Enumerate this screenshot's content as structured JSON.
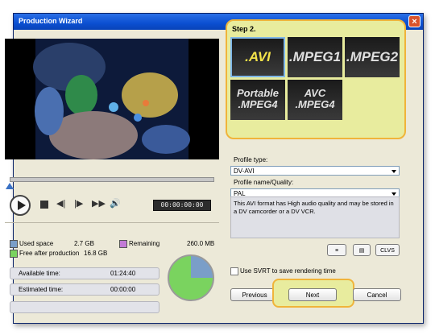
{
  "window": {
    "title": "Production Wizard",
    "close_symbol": "×"
  },
  "player": {
    "timecode": "00:00:00:00"
  },
  "disk": {
    "used_label": "Used space",
    "used_value": "2.7 GB",
    "remaining_label": "Remaining",
    "remaining_value": "260.0 MB",
    "free_label": "Free after production",
    "free_value": "16.8 GB",
    "used_color": "#7a9ec8",
    "free_color": "#7ad35f",
    "remaining_color": "#c27ad6"
  },
  "times": {
    "available_label": "Available time:",
    "available_value": "01:24:40",
    "estimated_label": "Estimated time:",
    "estimated_value": "00:00:00"
  },
  "step": {
    "label": "Step 2.",
    "formats": [
      {
        "line1": ".AVI",
        "line2": "",
        "selected": true
      },
      {
        "line1": ".MPEG1",
        "line2": "",
        "selected": false
      },
      {
        "line1": ".MPEG2",
        "line2": "",
        "selected": false
      },
      {
        "line1": "Portable",
        "line2": ".MPEG4",
        "selected": false
      },
      {
        "line1": "AVC",
        "line2": ".MPEG4",
        "selected": false
      }
    ]
  },
  "profile": {
    "type_label": "Profile type:",
    "type_value": "DV-AVI",
    "quality_label": "Profile name/Quality:",
    "quality_value": "PAL",
    "description": "This AVI format has High audio quality and may be stored in a DV camcorder or a DV VCR."
  },
  "tools": {
    "clvs_label": "CLVS"
  },
  "svrt": {
    "label": "Use SVRT to save rendering time",
    "checked": false
  },
  "nav": {
    "previous": "Previous",
    "next": "Next",
    "cancel": "Cancel"
  }
}
